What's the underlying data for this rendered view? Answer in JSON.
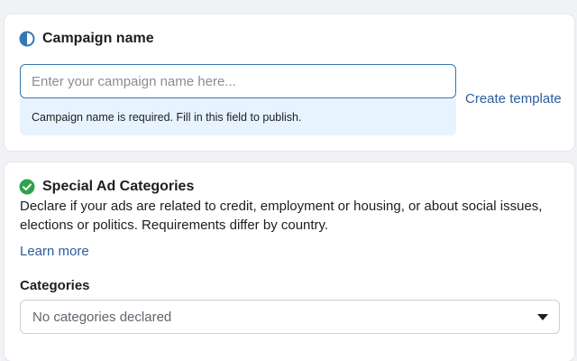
{
  "campaign_name": {
    "heading": "Campaign name",
    "input_value": "",
    "input_placeholder": "Enter your campaign name here...",
    "error_message": "Campaign name is required. Fill in this field to publish.",
    "create_template_label": "Create template",
    "status_icon": "half-circle-icon"
  },
  "special_ad_categories": {
    "heading": "Special Ad Categories",
    "description": "Declare if your ads are related to credit, employment or housing, or about social issues, elections or politics. Requirements differ by country.",
    "learn_more_label": "Learn more",
    "categories_label": "Categories",
    "categories_selected": "No categories declared",
    "status_icon": "check-circle-icon"
  },
  "colors": {
    "accent_blue": "#3578b5",
    "link_blue": "#2b5d9c",
    "success_green": "#31a24c",
    "info_background": "#e7f3ff"
  }
}
